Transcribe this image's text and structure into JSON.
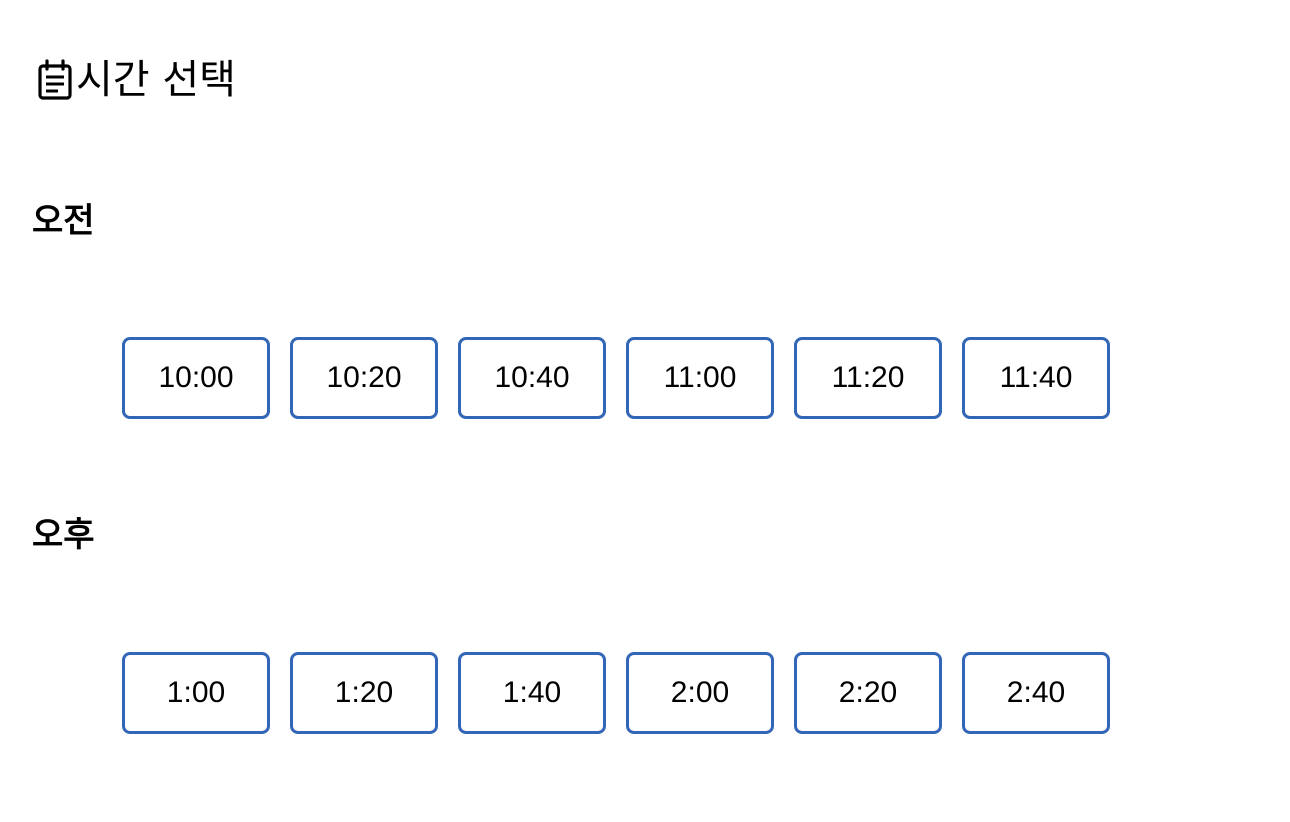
{
  "header": {
    "icon": "calendar-icon",
    "title": "시간 선택"
  },
  "sections": {
    "am": {
      "label": "오전",
      "slots": [
        "10:00",
        "10:20",
        "10:40",
        "11:00",
        "11:20",
        "11:40"
      ]
    },
    "pm": {
      "label": "오후",
      "slots": [
        "1:00",
        "1:20",
        "1:40",
        "2:00",
        "2:20",
        "2:40"
      ]
    }
  },
  "colors": {
    "slot_border": "#3466b8",
    "text": "#000000",
    "background": "#ffffff"
  }
}
